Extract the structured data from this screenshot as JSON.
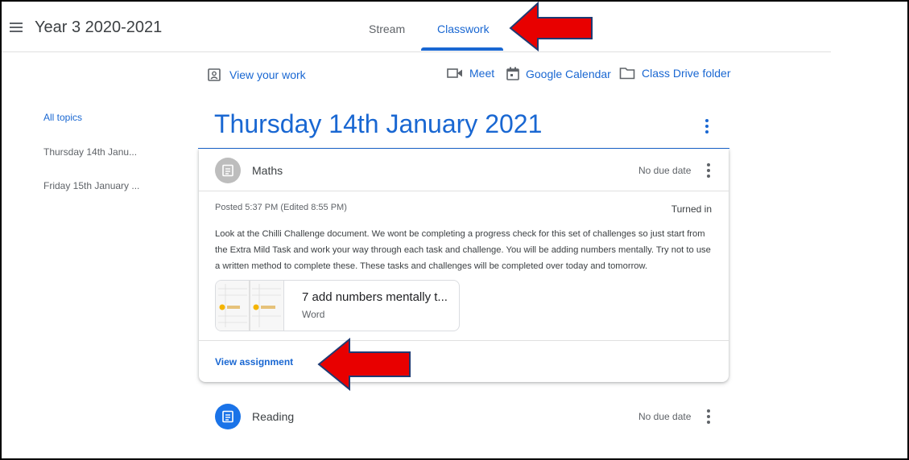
{
  "header": {
    "class_title": "Year 3 2020-2021",
    "tabs": [
      {
        "label": "Stream",
        "active": false
      },
      {
        "label": "Classwork",
        "active": true
      }
    ]
  },
  "toolbar": {
    "view_work": "View your work",
    "links": [
      {
        "label": "Meet",
        "icon": "video-camera-icon"
      },
      {
        "label": "Google Calendar",
        "icon": "calendar-icon"
      },
      {
        "label": "Class Drive folder",
        "icon": "folder-icon"
      }
    ]
  },
  "sidebar": {
    "items": [
      {
        "label": "All topics",
        "active": true
      },
      {
        "label": "Thursday 14th Janu...",
        "active": false
      },
      {
        "label": "Friday 15th January ...",
        "active": false
      }
    ]
  },
  "topic": {
    "title": "Thursday 14th January 2021"
  },
  "assignments": [
    {
      "title": "Maths",
      "due": "No due date",
      "posted": "Posted 5:37 PM (Edited 8:55 PM)",
      "status": "Turned in",
      "description": "Look at the Chilli Challenge document. We wont be completing a progress check for this set of challenges so just start from the Extra Mild Task and work your way through each task and challenge. You will be adding numbers mentally. Try not to use a written method to complete these. These tasks and challenges will be completed over today and tomorrow.",
      "attachment": {
        "name": "7 add numbers mentally t...",
        "type": "Word"
      },
      "action": "View assignment",
      "expanded": true
    },
    {
      "title": "Reading",
      "due": "No due date",
      "expanded": false
    }
  ],
  "colors": {
    "accent": "#1967d2",
    "annotation_arrow": "#e80000"
  }
}
